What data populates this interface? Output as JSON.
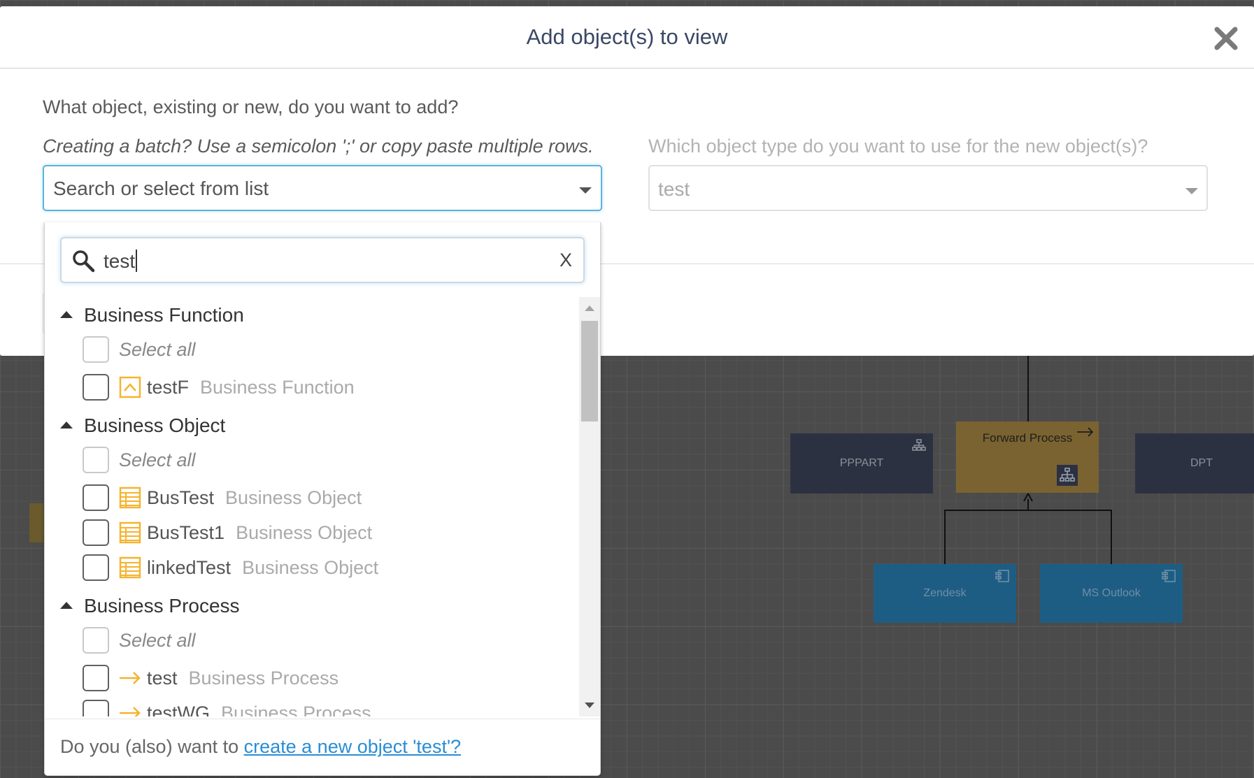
{
  "modal": {
    "title": "Add object(s) to view",
    "question": "What object, existing or new, do you want to add?",
    "batch_hint": "Creating a batch? Use a semicolon ';' or copy paste multiple rows.",
    "type_question": "Which object type do you want to use for the new object(s)?",
    "object_select": {
      "placeholder": "Search or select from list"
    },
    "type_select": {
      "value": "test"
    }
  },
  "dropdown": {
    "search": {
      "value": "test",
      "clear_label": "X"
    },
    "select_all_label": "Select all",
    "groups": [
      {
        "name": "Business Function",
        "items": [
          {
            "name": "testF",
            "type": "Business Function",
            "icon": "business-function-icon"
          }
        ]
      },
      {
        "name": "Business Object",
        "items": [
          {
            "name": "BusTest",
            "type": "Business Object",
            "icon": "business-object-icon"
          },
          {
            "name": "BusTest1",
            "type": "Business Object",
            "icon": "business-object-icon"
          },
          {
            "name": "linkedTest",
            "type": "Business Object",
            "icon": "business-object-icon"
          }
        ]
      },
      {
        "name": "Business Process",
        "items": [
          {
            "name": "test",
            "type": "Business Process",
            "icon": "business-process-icon"
          },
          {
            "name": "testWG",
            "type": "Business Process",
            "icon": "business-process-icon"
          }
        ]
      }
    ],
    "footer": {
      "text": "Do you (also) want to ",
      "link": "create a new object 'test'?"
    }
  },
  "canvas": {
    "nodes": {
      "ppart": "PPPART",
      "forward_process": "Forward Process",
      "dpt": "DPT",
      "zendesk": "Zendesk",
      "ms_outlook": "MS Outlook"
    }
  },
  "colors": {
    "accent": "#2a8dd4",
    "focus": "#5bb1de",
    "icon_orange": "#f5b32e",
    "title": "#3a4865"
  }
}
